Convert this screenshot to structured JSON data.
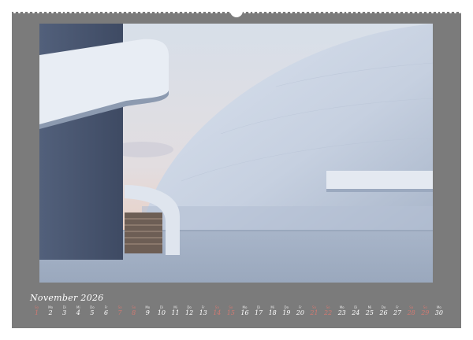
{
  "calendar": {
    "month_label": "November 2026",
    "days": [
      {
        "dow": "So",
        "num": "1",
        "weekend": true
      },
      {
        "dow": "Mo",
        "num": "2",
        "weekend": false
      },
      {
        "dow": "Di",
        "num": "3",
        "weekend": false
      },
      {
        "dow": "Mi",
        "num": "4",
        "weekend": false
      },
      {
        "dow": "Do",
        "num": "5",
        "weekend": false
      },
      {
        "dow": "Fr",
        "num": "6",
        "weekend": false
      },
      {
        "dow": "Sa",
        "num": "7",
        "weekend": true
      },
      {
        "dow": "So",
        "num": "8",
        "weekend": true
      },
      {
        "dow": "Mo",
        "num": "9",
        "weekend": false
      },
      {
        "dow": "Di",
        "num": "10",
        "weekend": false
      },
      {
        "dow": "Mi",
        "num": "11",
        "weekend": false
      },
      {
        "dow": "Do",
        "num": "12",
        "weekend": false
      },
      {
        "dow": "Fr",
        "num": "13",
        "weekend": false
      },
      {
        "dow": "Sa",
        "num": "14",
        "weekend": true
      },
      {
        "dow": "So",
        "num": "15",
        "weekend": true
      },
      {
        "dow": "Mo",
        "num": "16",
        "weekend": false
      },
      {
        "dow": "Di",
        "num": "17",
        "weekend": false
      },
      {
        "dow": "Mi",
        "num": "18",
        "weekend": false
      },
      {
        "dow": "Do",
        "num": "19",
        "weekend": false
      },
      {
        "dow": "Fr",
        "num": "20",
        "weekend": false
      },
      {
        "dow": "Sa",
        "num": "21",
        "weekend": true
      },
      {
        "dow": "So",
        "num": "22",
        "weekend": true
      },
      {
        "dow": "Mo",
        "num": "23",
        "weekend": false
      },
      {
        "dow": "Di",
        "num": "24",
        "weekend": false
      },
      {
        "dow": "Mi",
        "num": "25",
        "weekend": false
      },
      {
        "dow": "Do",
        "num": "26",
        "weekend": false
      },
      {
        "dow": "Fr",
        "num": "27",
        "weekend": false
      },
      {
        "dow": "Sa",
        "num": "28",
        "weekend": true
      },
      {
        "dow": "So",
        "num": "29",
        "weekend": true
      },
      {
        "dow": "Mo",
        "num": "30",
        "weekend": false
      }
    ]
  },
  "colors": {
    "frame": "#7b7b7b",
    "weekend": "#d07a72",
    "sky_top": "#c9d4e2",
    "sky_bottom": "#e9c9b8",
    "dome": "#cfd8e6"
  }
}
